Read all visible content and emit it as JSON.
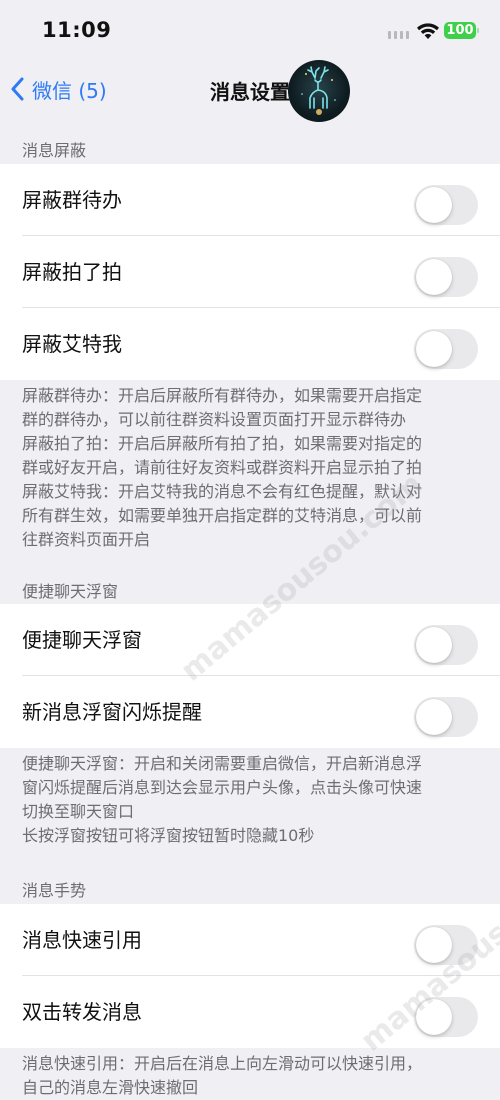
{
  "status_bar": {
    "time": "11:09",
    "battery": "100"
  },
  "nav": {
    "back_label": "微信 (5)",
    "title": "消息设置"
  },
  "sections": {
    "block": {
      "header": "消息屏蔽",
      "rows": [
        "屏蔽群待办",
        "屏蔽拍了拍",
        "屏蔽艾特我"
      ],
      "footnote": [
        "屏蔽群待办：开启后屏蔽所有群待办，如果需要开启指定",
        "群的群待办，可以前往群资料设置页面打开显示群待办",
        "屏蔽拍了拍：开启后屏蔽所有拍了拍，如果需要对指定的",
        "群或好友开启，请前往好友资料或群资料开启显示拍了拍",
        "屏蔽艾特我：开启艾特我的消息不会有红色提醒，默认对",
        "所有群生效，如需要单独开启指定群的艾特消息，可以前",
        "往群资料页面开启"
      ]
    },
    "floating": {
      "header": "便捷聊天浮窗",
      "rows": [
        "便捷聊天浮窗",
        "新消息浮窗闪烁提醒"
      ],
      "footnote": [
        "便捷聊天浮窗：开启和关闭需要重启微信，开启新消息浮",
        "窗闪烁提醒后消息到达会显示用户头像，点击头像可快速",
        "切换至聊天窗口",
        "长按浮窗按钮可将浮窗按钮暂时隐藏10秒"
      ]
    },
    "gesture": {
      "header": "消息手势",
      "rows": [
        "消息快速引用",
        "双击转发消息"
      ],
      "footnote": [
        "消息快速引用：开启后在消息上向左滑动可以快速引用，",
        "自己的消息左滑快速撤回"
      ]
    }
  },
  "watermark": "mamasousou.com",
  "colors": {
    "accent": "#2f7bf5",
    "background": "#efeff4",
    "battery": "#3fcf4a"
  }
}
